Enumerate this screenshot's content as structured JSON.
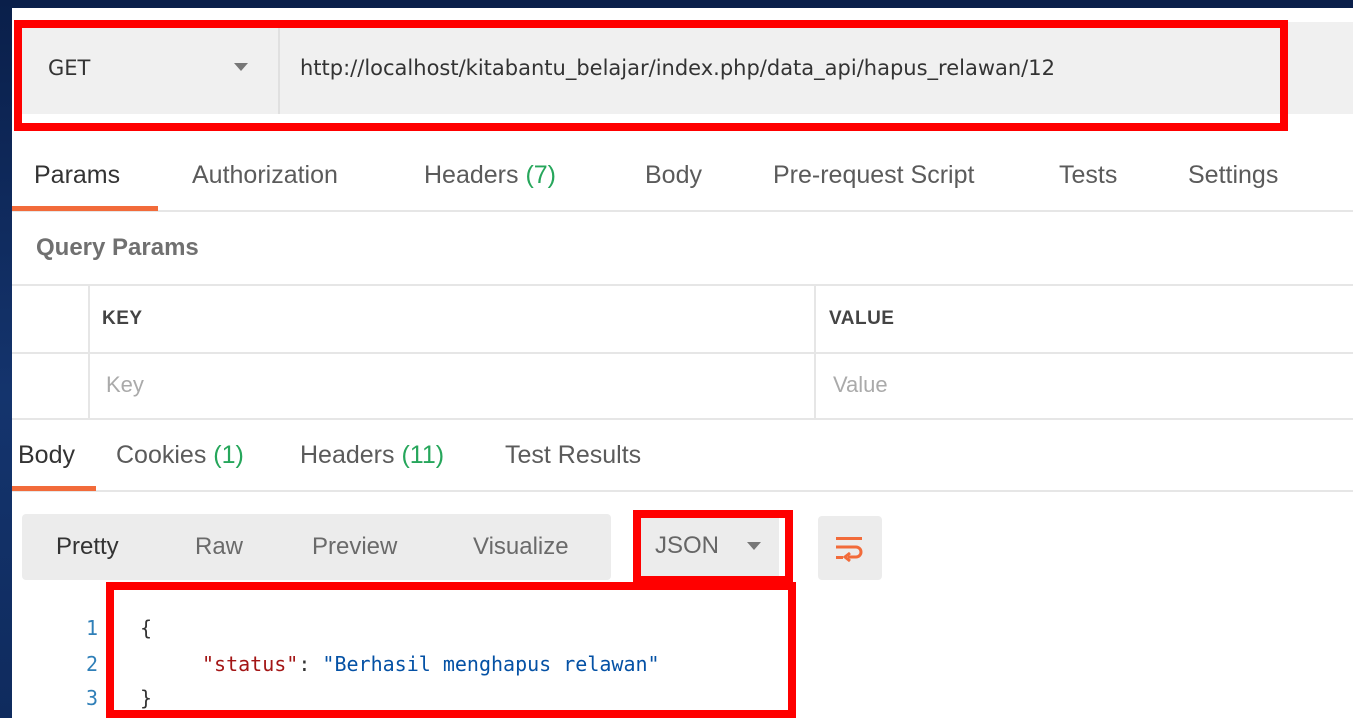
{
  "request": {
    "method": "GET",
    "url": "http://localhost/kitabantu_belajar/index.php/data_api/hapus_relawan/12"
  },
  "request_tabs": [
    {
      "label": "Params",
      "count": ""
    },
    {
      "label": "Authorization",
      "count": ""
    },
    {
      "label": "Headers",
      "count": "(7)"
    },
    {
      "label": "Body",
      "count": ""
    },
    {
      "label": "Pre-request Script",
      "count": ""
    },
    {
      "label": "Tests",
      "count": ""
    },
    {
      "label": "Settings",
      "count": ""
    }
  ],
  "query_params": {
    "title": "Query Params",
    "key_header": "KEY",
    "value_header": "VALUE",
    "key_placeholder": "Key",
    "value_placeholder": "Value"
  },
  "response_tabs": [
    {
      "label": "Body",
      "count": ""
    },
    {
      "label": "Cookies",
      "count": "(1)"
    },
    {
      "label": "Headers",
      "count": "(11)"
    },
    {
      "label": "Test Results",
      "count": ""
    }
  ],
  "response_toolbar": {
    "views": [
      "Pretty",
      "Raw",
      "Preview",
      "Visualize"
    ],
    "format": "JSON",
    "wrap_icon": "wrap-lines-icon"
  },
  "response_body": {
    "line_numbers": [
      "1",
      "2",
      "3"
    ],
    "open_brace": "{",
    "key": "\"status\"",
    "separator": ": ",
    "value": "\"Berhasil menghapus relawan\"",
    "close_brace": "}"
  },
  "colors": {
    "accent": "#f26b3a",
    "count": "#26a65b",
    "highlight": "#ff0000"
  }
}
